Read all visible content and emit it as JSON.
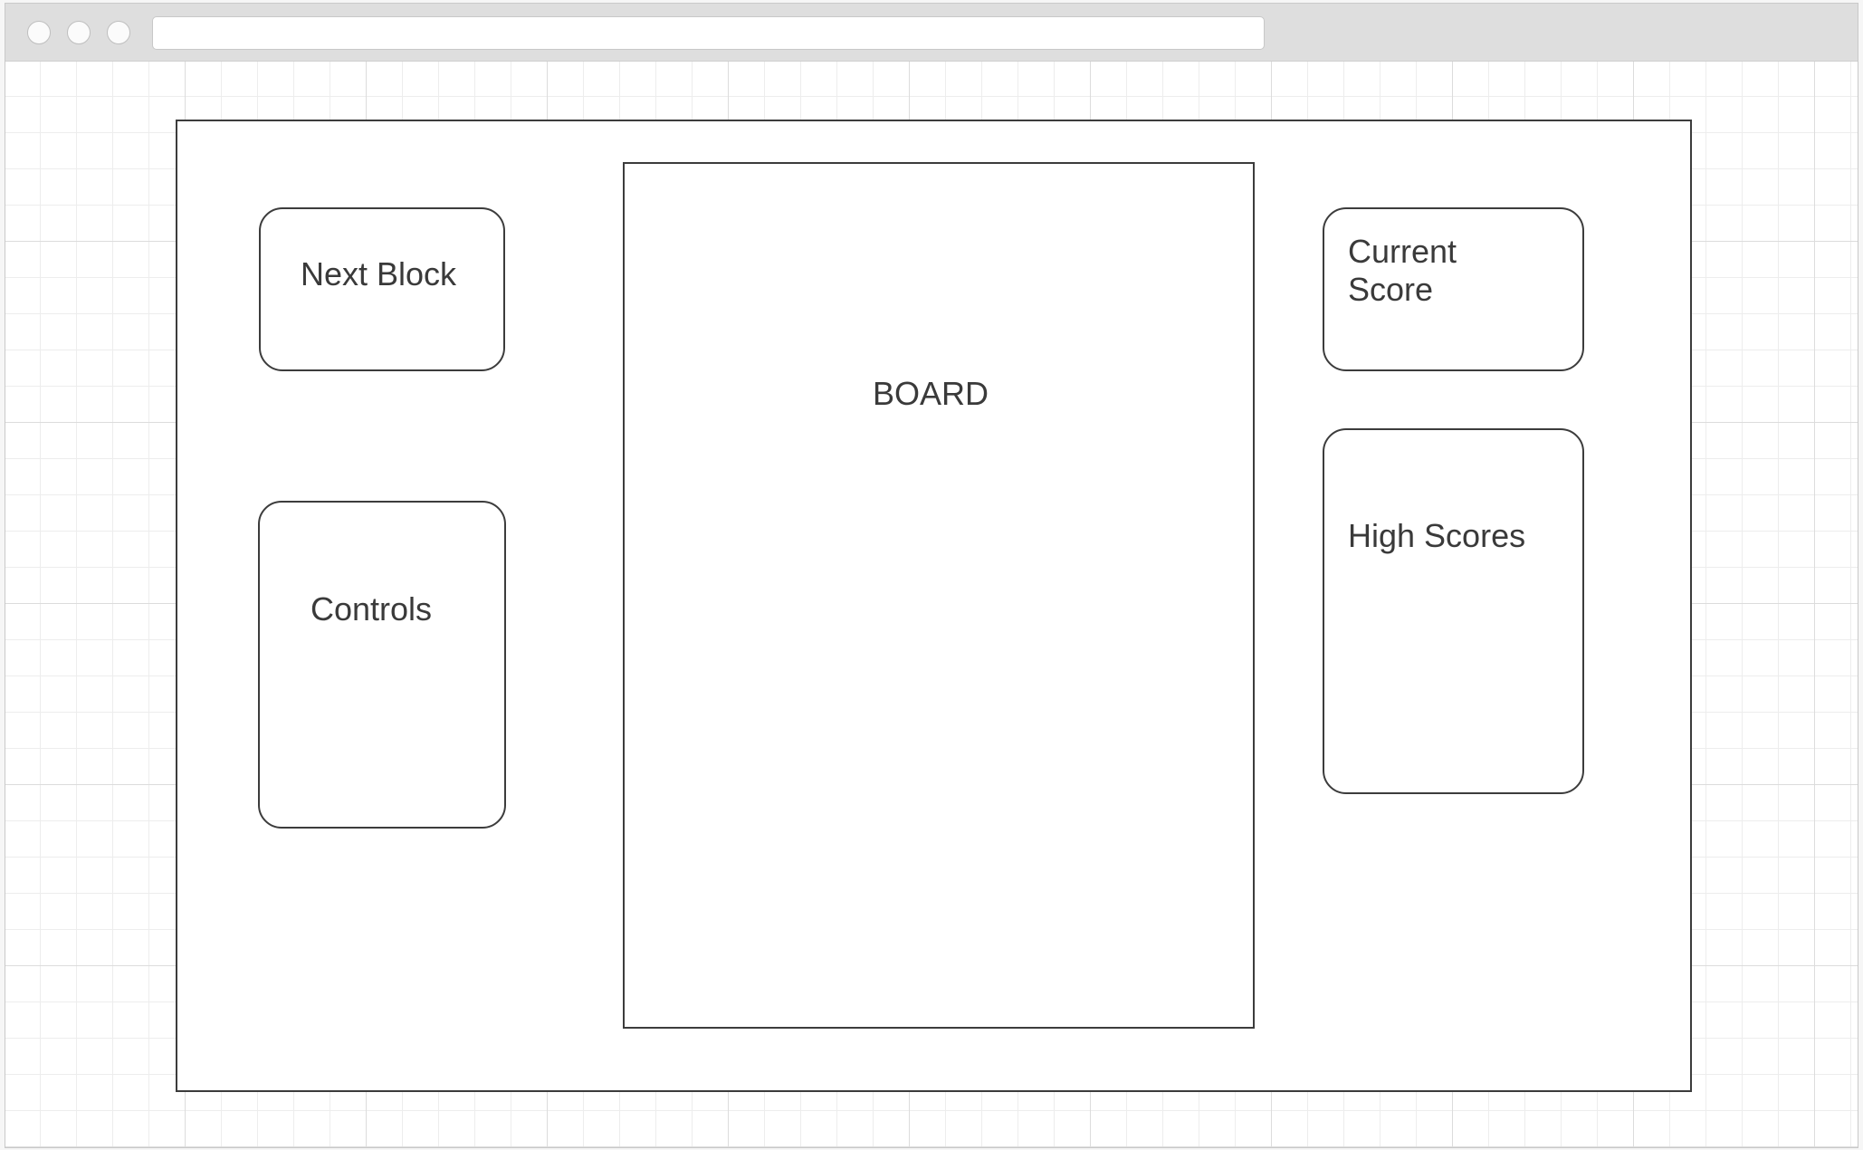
{
  "window": {
    "traffic_lights": [
      "close-button",
      "minimize-button",
      "maximize-button"
    ],
    "address_bar": {
      "value": ""
    }
  },
  "wireframe": {
    "next_block": {
      "label": "Next Block"
    },
    "controls": {
      "label": "Controls"
    },
    "board": {
      "label": "BOARD"
    },
    "current_score": {
      "label": "Current\nScore"
    },
    "high_scores": {
      "label": "High Scores"
    }
  },
  "colors": {
    "stroke": "#3c3c3c",
    "text": "#3a3a3a",
    "grid": "#dcdcdc",
    "chrome": "#dedede"
  }
}
